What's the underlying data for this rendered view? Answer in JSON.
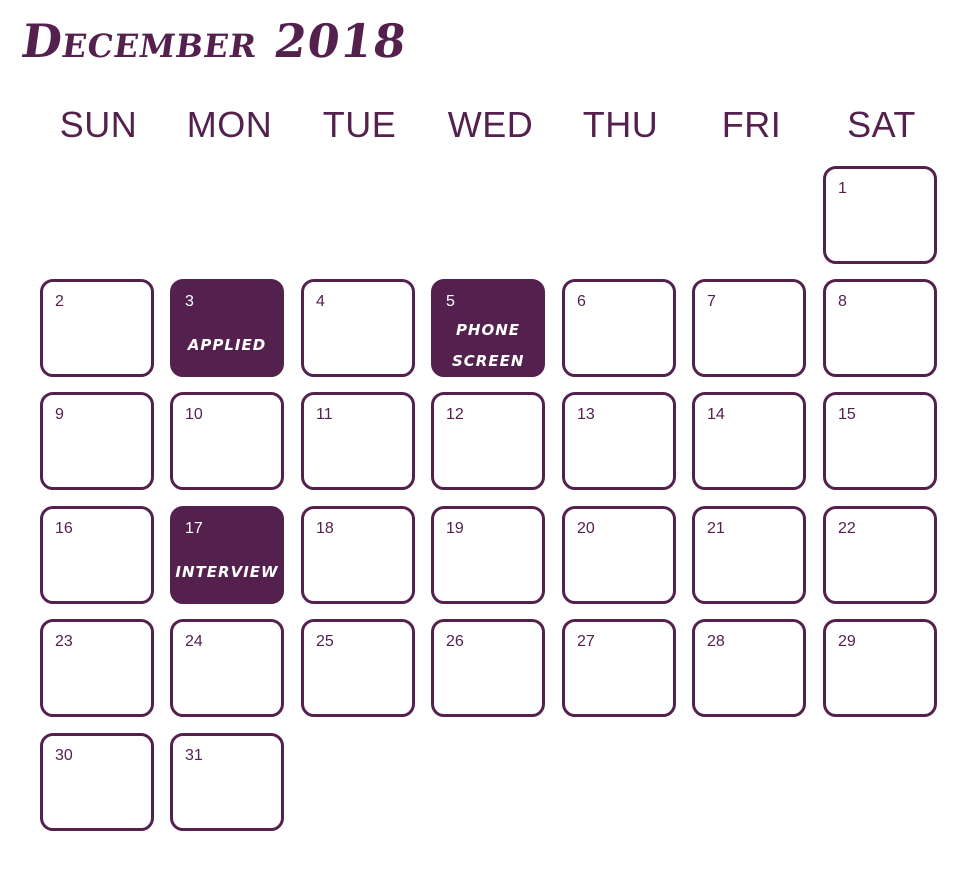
{
  "calendar": {
    "title": "December 2018",
    "weekdays": [
      "SUN",
      "MON",
      "TUE",
      "WED",
      "THU",
      "FRI",
      "SAT"
    ],
    "days": [
      {
        "day": "1"
      },
      {
        "day": "2"
      },
      {
        "day": "3",
        "event": "applied",
        "highlighted": true
      },
      {
        "day": "4"
      },
      {
        "day": "5",
        "event": "phone screen",
        "highlighted": true
      },
      {
        "day": "6"
      },
      {
        "day": "7"
      },
      {
        "day": "8"
      },
      {
        "day": "9"
      },
      {
        "day": "10"
      },
      {
        "day": "11"
      },
      {
        "day": "12"
      },
      {
        "day": "13"
      },
      {
        "day": "14"
      },
      {
        "day": "15"
      },
      {
        "day": "16"
      },
      {
        "day": "17",
        "event": "interview",
        "highlighted": true
      },
      {
        "day": "18"
      },
      {
        "day": "19"
      },
      {
        "day": "20"
      },
      {
        "day": "21"
      },
      {
        "day": "22"
      },
      {
        "day": "23"
      },
      {
        "day": "24"
      },
      {
        "day": "25"
      },
      {
        "day": "26"
      },
      {
        "day": "27"
      },
      {
        "day": "28"
      },
      {
        "day": "29"
      },
      {
        "day": "30"
      },
      {
        "day": "31"
      }
    ]
  },
  "colors": {
    "accent": "#54214f",
    "background": "#ffffff",
    "event_text": "#ffffff"
  }
}
